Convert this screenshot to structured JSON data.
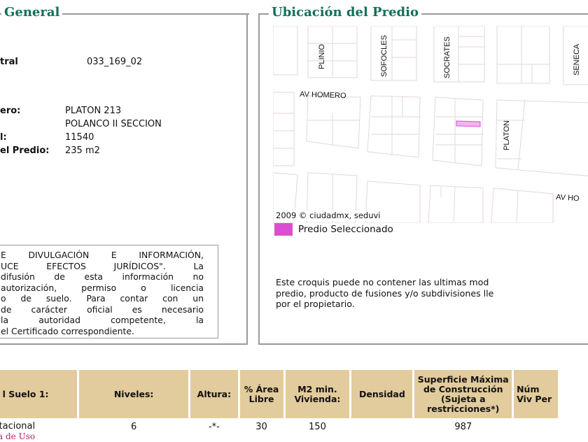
{
  "general": {
    "title": "General",
    "cuenta_label": "tral",
    "cuenta_value": "033_169_02",
    "calle_label": "ero:",
    "calle_value": "PLATON 213",
    "colonia_value": "POLANCO II SECCION",
    "cp_label": "l:",
    "cp_value": "11540",
    "superficie_label": "el Predio:",
    "superficie_value": "235 m2",
    "disclaimer_lines": [
      "E DIVULGACIÓN E INFORMACIÓN,",
      "UCE EFECTOS JURÍDICOS\". La",
      "difusión de esta información no",
      "autorización, permiso o licencia",
      "o de suelo. Para contar con un",
      "de carácter oficial es necesario",
      "la autoridad competente, la",
      "el Certificado correspondiente."
    ]
  },
  "ubicacion": {
    "title": "Ubicación del Predio",
    "streets": [
      "PLINIO",
      "SOFOCLES",
      "SOCRATES",
      "SENECA",
      "AV HOMERO",
      "PLATON",
      "AV HO"
    ],
    "credit": "2009 © ciudadmx, seduvi",
    "legend_label": "Predio Seleccionado",
    "legend_color": "#d94fcf",
    "note_lines": [
      "Este croquis puede no contener las ultimas mod",
      "predio, producto de fusiones y/o subdivisiones lle",
      "por el propietario."
    ]
  },
  "table": {
    "headers": [
      "l Suelo 1:",
      "Niveles:",
      "Altura:",
      "% Área Libre",
      "M2 min. Vivienda:",
      "Densidad",
      "Superficie Máxima de Construcción (Sujeta a restricciones*)",
      "Núm Viv Per"
    ],
    "row": {
      "uso": "tacional",
      "uso_link": "bla de Uso",
      "niveles": "6",
      "altura": "-*-",
      "area_libre": "30",
      "m2_min": "150",
      "densidad": "",
      "superficie_max": "987",
      "num_viviendas": ""
    },
    "header_color": "#e2cb9c"
  }
}
